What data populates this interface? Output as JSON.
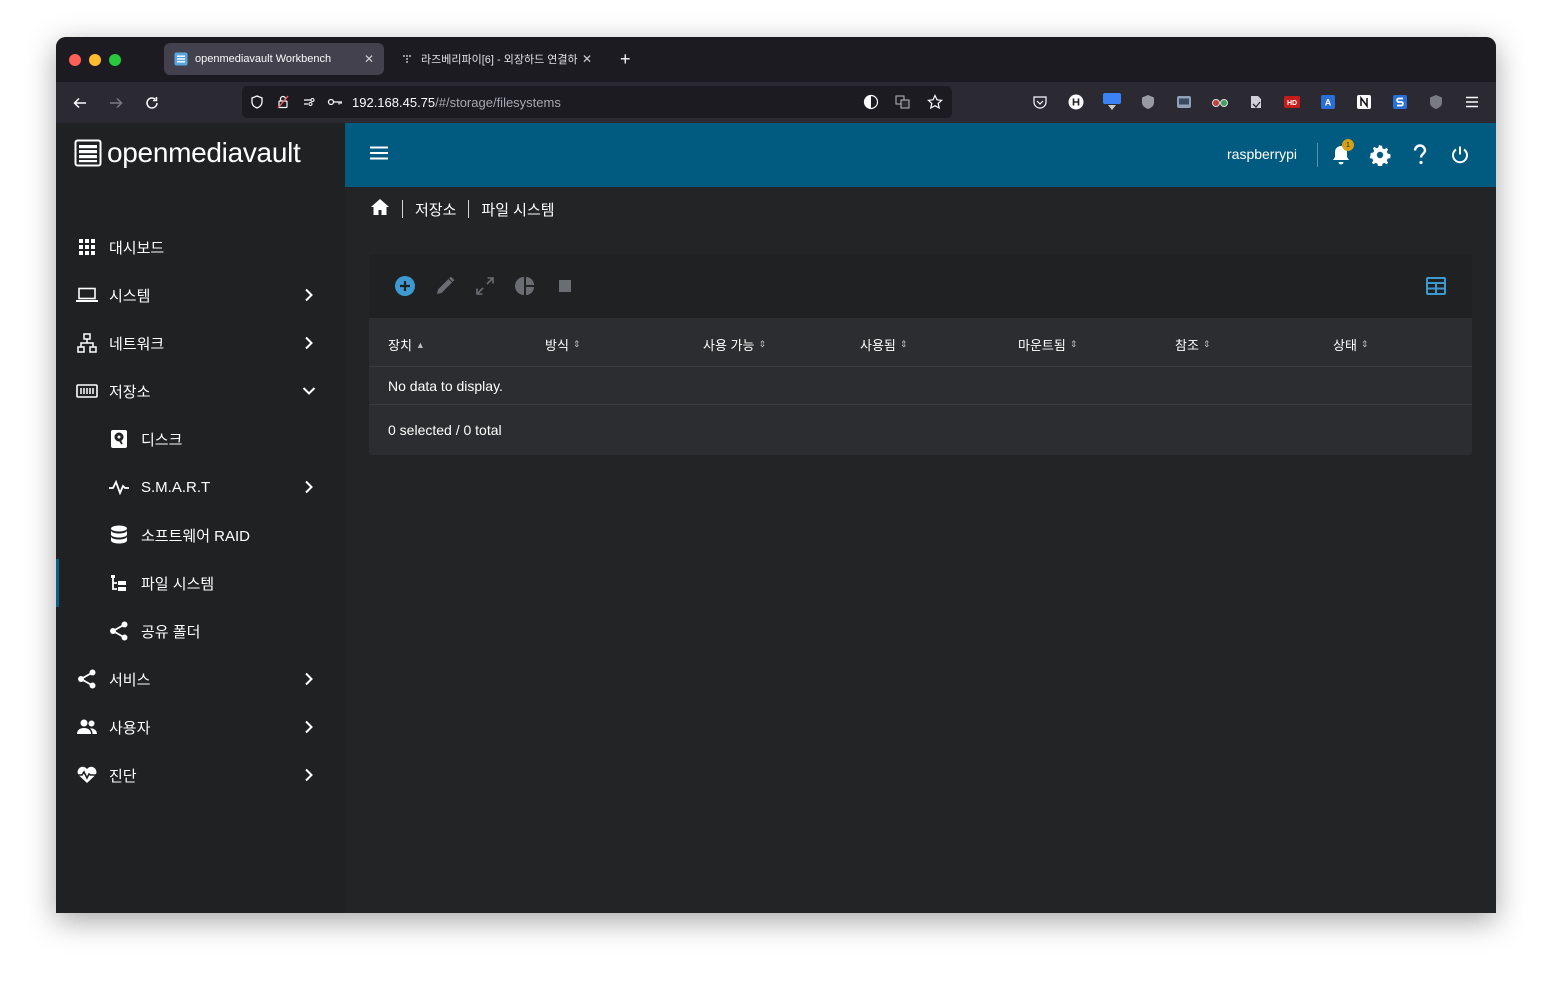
{
  "browser": {
    "tabs": [
      {
        "title": "openmediavault Workbench",
        "active": true
      },
      {
        "title": "라즈베리파이[6] - 외장하드 연결하기",
        "active": false
      }
    ],
    "url_host": "192.168.45.75",
    "url_path": "/#/storage/filesystems",
    "new_tab_label": "+",
    "close_label": "✕"
  },
  "app": {
    "brand": "openmediavault",
    "hostname": "raspberrypi",
    "notification_count": "1",
    "accent_color": "#015a80",
    "primary_icon_color": "#3d9ad1"
  },
  "sidebar": {
    "items": [
      {
        "label": "대시보드",
        "icon": "dashboard-icon"
      },
      {
        "label": "시스템",
        "icon": "laptop-icon"
      },
      {
        "label": "네트워크",
        "icon": "network-icon"
      },
      {
        "label": "저장소",
        "icon": "storage-icon"
      },
      {
        "label": "디스크",
        "icon": "disk-icon"
      },
      {
        "label": "S.M.A.R.T",
        "icon": "pulse-icon"
      },
      {
        "label": "소프트웨어 RAID",
        "icon": "database-icon"
      },
      {
        "label": "파일 시스템",
        "icon": "file-tree-icon"
      },
      {
        "label": "공유 폴더",
        "icon": "share-icon"
      },
      {
        "label": "서비스",
        "icon": "share-icon"
      },
      {
        "label": "사용자",
        "icon": "users-icon"
      },
      {
        "label": "진단",
        "icon": "heart-pulse-icon"
      }
    ]
  },
  "breadcrumb": {
    "items": [
      "저장소",
      "파일 시스템"
    ]
  },
  "table": {
    "columns": [
      "장치",
      "방식",
      "사용 가능",
      "사용됨",
      "마운트됨",
      "참조",
      "상태"
    ],
    "empty_message": "No data to display.",
    "footer": "0 selected / 0 total"
  }
}
